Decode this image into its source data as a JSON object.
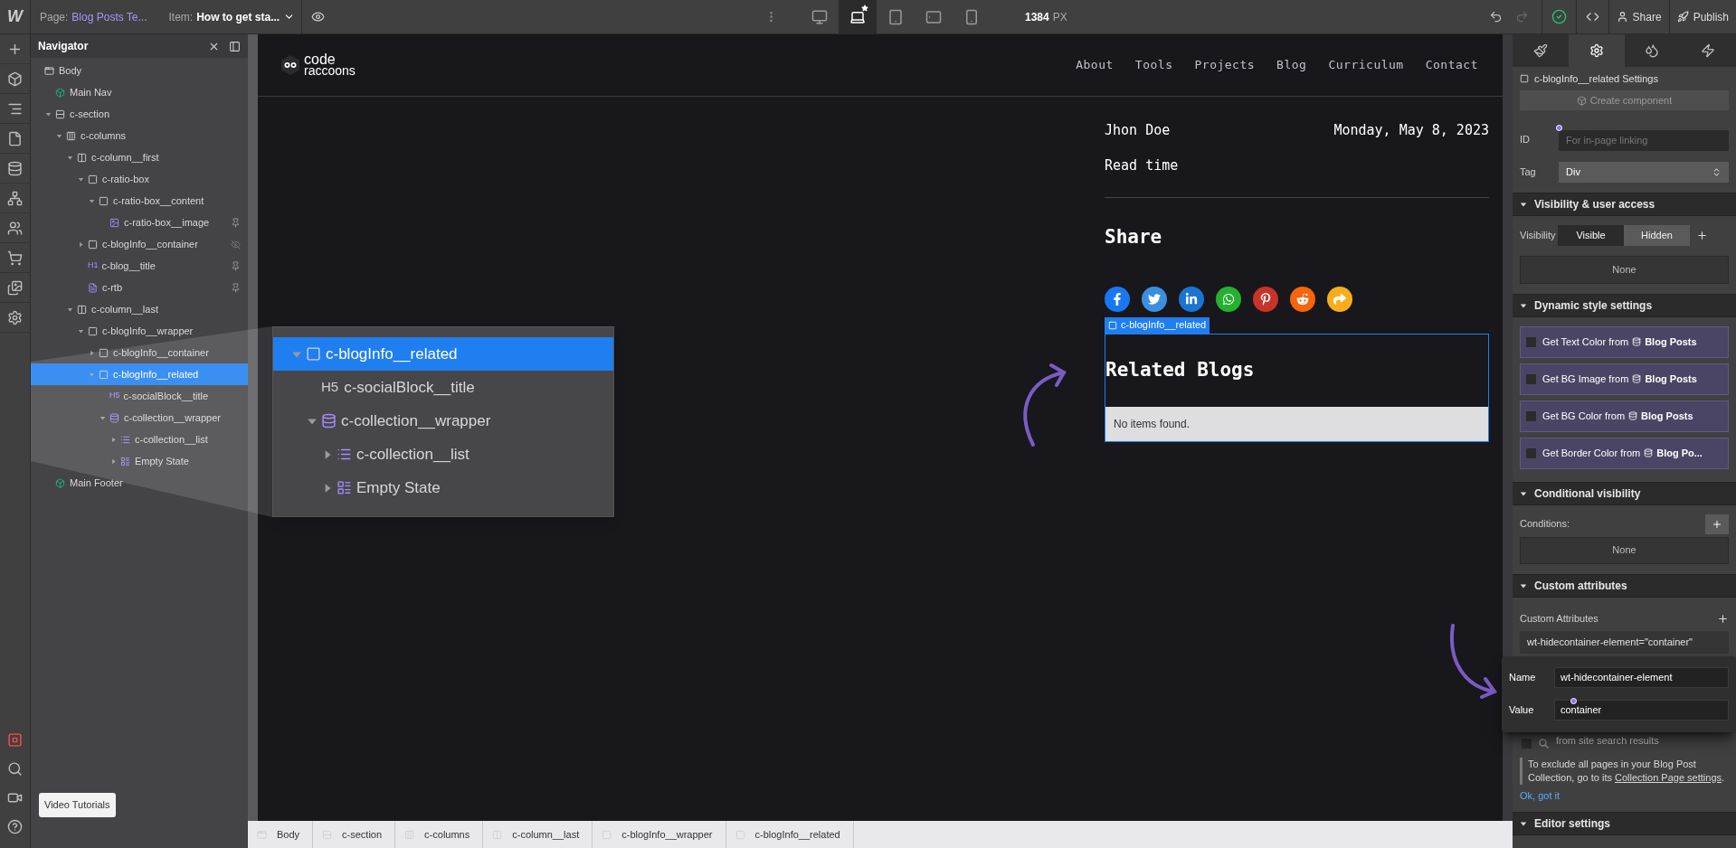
{
  "topbar": {
    "logo": "W",
    "page_label": "Page:",
    "page_name": "Blog Posts Te...",
    "item_label": "Item:",
    "item_name": "How to get sta...",
    "devices": [
      {
        "kind": "desktop",
        "selected": false
      },
      {
        "kind": "laptop",
        "selected": true
      },
      {
        "kind": "tablet",
        "selected": false
      },
      {
        "kind": "tablet-landscape",
        "selected": false
      },
      {
        "kind": "phone",
        "selected": false
      }
    ],
    "width_value": "1384",
    "width_unit": "PX",
    "saved": true,
    "actions": [
      {
        "kind": "share",
        "label": "Share"
      },
      {
        "kind": "publish",
        "label": "Publish"
      }
    ]
  },
  "rail": {
    "top": [
      {
        "kind": "add"
      },
      {
        "kind": "components"
      },
      {
        "kind": "navigator"
      },
      {
        "kind": "pages"
      },
      {
        "kind": "cms"
      },
      {
        "kind": "logic"
      },
      {
        "kind": "users"
      },
      {
        "kind": "ecommerce"
      },
      {
        "kind": "assets"
      },
      {
        "kind": "settings"
      }
    ],
    "bottom": [
      {
        "kind": "record"
      },
      {
        "kind": "search"
      },
      {
        "kind": "tutorials"
      },
      {
        "kind": "help"
      }
    ],
    "tooltip": "Video Tutorials"
  },
  "navigator": {
    "title": "Navigator",
    "tree": [
      {
        "label": "Body",
        "kind": "body",
        "selected": false,
        "children": [
          {
            "label": "Main Nav",
            "kind": "component",
            "selected": false
          },
          {
            "label": "c-section",
            "kind": "section",
            "expanded": true,
            "selected": false,
            "children": [
              {
                "label": "c-columns",
                "kind": "columns",
                "expanded": true,
                "selected": false,
                "children": [
                  {
                    "label": "c-column__first",
                    "kind": "column",
                    "expanded": true,
                    "selected": false,
                    "children": [
                      {
                        "label": "c-ratio-box",
                        "kind": "div",
                        "expanded": true,
                        "selected": false,
                        "children": [
                          {
                            "label": "c-ratio-box__content",
                            "kind": "div",
                            "expanded": true,
                            "selected": false,
                            "children": [
                              {
                                "label": "c-ratio-box__image",
                                "kind": "image",
                                "selected": false,
                                "pinned": true
                              }
                            ]
                          }
                        ]
                      },
                      {
                        "label": "c-blogInfo__container",
                        "kind": "div",
                        "expanded": false,
                        "selected": false,
                        "hidden": true
                      },
                      {
                        "label": "c-blog__title",
                        "kind": "heading",
                        "tag": "H1",
                        "selected": false,
                        "pinned": true
                      },
                      {
                        "label": "c-rtb",
                        "kind": "rtb",
                        "selected": false,
                        "pinned": true
                      }
                    ]
                  },
                  {
                    "label": "c-column__last",
                    "kind": "column",
                    "expanded": true,
                    "selected": false,
                    "children": [
                      {
                        "label": "c-blogInfo__wrapper",
                        "kind": "div",
                        "expanded": true,
                        "selected": false,
                        "children": [
                          {
                            "label": "c-blogInfo__container",
                            "kind": "div",
                            "expanded": false,
                            "selected": false
                          },
                          {
                            "label": "c-blogInfo__related",
                            "kind": "div",
                            "expanded": true,
                            "selected": true,
                            "children": [
                              {
                                "label": "c-socialBlock__title",
                                "kind": "heading",
                                "tag": "H5",
                                "selected": false
                              },
                              {
                                "label": "c-collection__wrapper",
                                "kind": "collection-wrapper",
                                "expanded": true,
                                "selected": false,
                                "children": [
                                  {
                                    "label": "c-collection__list",
                                    "kind": "collection-list",
                                    "expanded": false,
                                    "selected": false
                                  },
                                  {
                                    "label": "Empty State",
                                    "kind": "empty-state",
                                    "expanded": false,
                                    "selected": false
                                  }
                                ]
                              }
                            ]
                          }
                        ]
                      }
                    ]
                  }
                ]
              }
            ]
          },
          {
            "label": "Main Footer",
            "kind": "component",
            "selected": false
          }
        ]
      }
    ]
  },
  "magnifier": {
    "tree": [
      {
        "label": "c-blogInfo__related",
        "kind": "div",
        "expanded": true,
        "selected": true,
        "children": [
          {
            "label": "c-socialBlock__title",
            "kind": "heading",
            "tag": "H5",
            "selected": false
          },
          {
            "label": "c-collection__wrapper",
            "kind": "collection-wrapper",
            "expanded": true,
            "selected": false,
            "children": [
              {
                "label": "c-collection__list",
                "kind": "collection-list",
                "expanded": false,
                "selected": false
              },
              {
                "label": "Empty State",
                "kind": "empty-state",
                "expanded": false,
                "selected": false
              }
            ]
          }
        ]
      }
    ]
  },
  "canvas": {
    "logo_top": "code",
    "logo_bottom": "raccoons",
    "nav": [
      "About",
      "Tools",
      "Projects",
      "Blog",
      "Curriculum",
      "Contact"
    ],
    "author": "Jhon Doe",
    "date": "Monday, May 8, 2023",
    "read_time": "Read time",
    "share_title": "Share",
    "social": [
      {
        "kind": "facebook",
        "color": "#1877f2"
      },
      {
        "kind": "twitter",
        "color": "#3b8fe0"
      },
      {
        "kind": "linkedin",
        "color": "#1b74d0"
      },
      {
        "kind": "whatsapp",
        "color": "#24b12f"
      },
      {
        "kind": "pinterest",
        "color": "#c8332a"
      },
      {
        "kind": "reddit",
        "color": "#f5650b"
      },
      {
        "kind": "share",
        "color": "#f8ae1c"
      }
    ],
    "selected_label": "c-blogInfo__related",
    "related_title": "Related Blogs",
    "empty_text": "No items found."
  },
  "breadcrumb": [
    {
      "kind": "body",
      "label": "Body"
    },
    {
      "kind": "section",
      "label": "c-section"
    },
    {
      "kind": "columns",
      "label": "c-columns"
    },
    {
      "kind": "column",
      "label": "c-column__last"
    },
    {
      "kind": "div",
      "label": "c-blogInfo__wrapper"
    },
    {
      "kind": "div",
      "label": "c-blogInfo__related"
    }
  ],
  "settings": {
    "tabs": [
      {
        "kind": "style",
        "selected": false
      },
      {
        "kind": "settings",
        "selected": true
      },
      {
        "kind": "interactions-drops",
        "selected": false
      },
      {
        "kind": "interactions",
        "selected": false
      }
    ],
    "title": "c-blogInfo__related Settings",
    "create_button": "Create component",
    "id_label": "ID",
    "id_placeholder": "For in-page linking",
    "tag_label": "Tag",
    "tag_value": "Div",
    "sections": [
      {
        "kind": "visibility",
        "title": "Visibility & user access",
        "expanded": true,
        "label": "Visibility",
        "segments": [
          {
            "label": "Visible",
            "selected": true
          },
          {
            "label": "Hidden",
            "selected": false
          }
        ],
        "access": "None"
      },
      {
        "kind": "dynamic",
        "title": "Dynamic style settings",
        "expanded": true,
        "rows": [
          {
            "text": "Get Text Color from",
            "source": "Blog Posts",
            "checked": false
          },
          {
            "text": "Get BG Image from",
            "source": "Blog Posts",
            "checked": false
          },
          {
            "text": "Get BG Color from",
            "source": "Blog Posts",
            "checked": false
          },
          {
            "text": "Get Border Color from",
            "source": "Blog Po...",
            "checked": false
          }
        ]
      },
      {
        "kind": "conditional",
        "title": "Conditional visibility",
        "expanded": true,
        "label": "Conditions:",
        "value": "None"
      },
      {
        "kind": "attributes",
        "title": "Custom attributes",
        "expanded": true,
        "label": "Custom Attributes",
        "attribute": "wt-hidecontainer-element=\"container\"",
        "popup": {
          "name_label": "Name",
          "name_value": "wt-hidecontainer-element",
          "value_label": "Value",
          "value_value": "container"
        },
        "search_text": "from site search results",
        "search_checked": false,
        "info_before": "To exclude all pages in your Blog Post Collection, go to its ",
        "info_link": "Collection Page settings",
        "info_after": ".",
        "dismiss": "Ok, got it"
      },
      {
        "kind": "editor",
        "title": "Editor settings",
        "expanded": true
      }
    ]
  }
}
